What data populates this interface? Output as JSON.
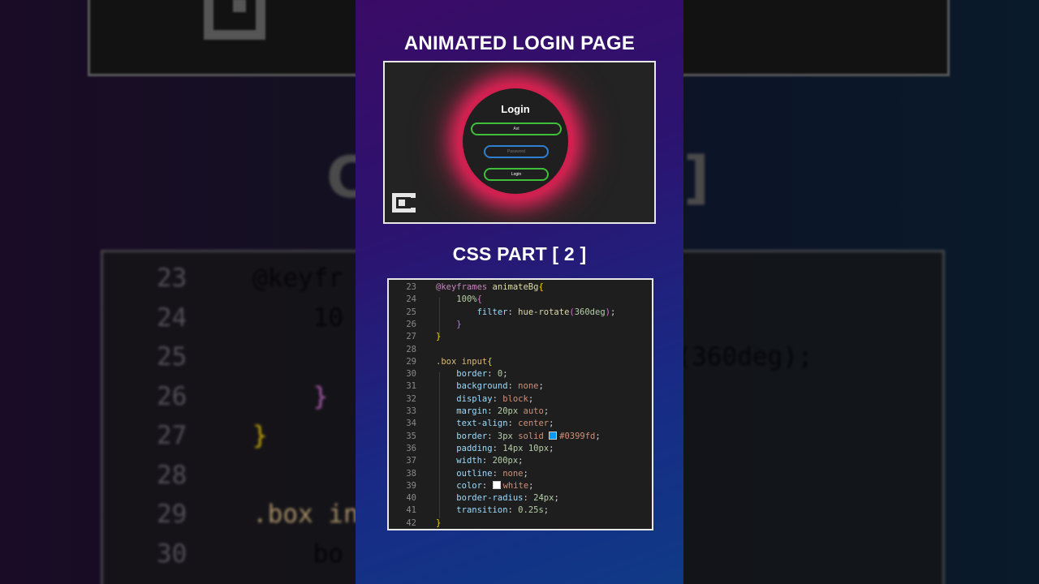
{
  "heading": "ANIMATED LOGIN PAGE",
  "subheading": "CSS PART [ 2 ]",
  "preview": {
    "login_title": "Login",
    "username_value": "Ast",
    "password_placeholder": "Password",
    "login_button": "Login",
    "glow_color": "#e8245a"
  },
  "code_lines": [
    {
      "n": "23",
      "text": "@keyframes animateBg{"
    },
    {
      "n": "24",
      "text": "    100%{"
    },
    {
      "n": "25",
      "text": "        filter: hue-rotate(360deg);"
    },
    {
      "n": "26",
      "text": "    }"
    },
    {
      "n": "27",
      "text": "}"
    },
    {
      "n": "28",
      "text": ""
    },
    {
      "n": "29",
      "text": ".box input{"
    },
    {
      "n": "30",
      "text": "    border: 0;"
    },
    {
      "n": "31",
      "text": "    background: none;"
    },
    {
      "n": "32",
      "text": "    display: block;"
    },
    {
      "n": "33",
      "text": "    margin: 20px auto;"
    },
    {
      "n": "34",
      "text": "    text-align: center;"
    },
    {
      "n": "35",
      "text": "    border: 3px solid #0399fd;"
    },
    {
      "n": "36",
      "text": "    padding: 14px 10px;"
    },
    {
      "n": "37",
      "text": "    width: 200px;"
    },
    {
      "n": "38",
      "text": "    outline: none;"
    },
    {
      "n": "39",
      "text": "    color: white;"
    },
    {
      "n": "40",
      "text": "    border-radius: 24px;"
    },
    {
      "n": "41",
      "text": "    transition: 0.25s;"
    },
    {
      "n": "42",
      "text": "}"
    }
  ],
  "bg_code_lines": [
    {
      "n": "23",
      "text": "@keyfr"
    },
    {
      "n": "24",
      "text": "    10"
    },
    {
      "n": "25",
      "text": "                           e(360deg);"
    },
    {
      "n": "26",
      "text": "    }"
    },
    {
      "n": "27",
      "text": "}"
    },
    {
      "n": "28",
      "text": ""
    },
    {
      "n": "29",
      "text": ".box i"
    },
    {
      "n": "30",
      "text": "    bo"
    }
  ],
  "colors": {
    "swatch_blue": "#0399fd",
    "swatch_white": "#ffffff"
  }
}
